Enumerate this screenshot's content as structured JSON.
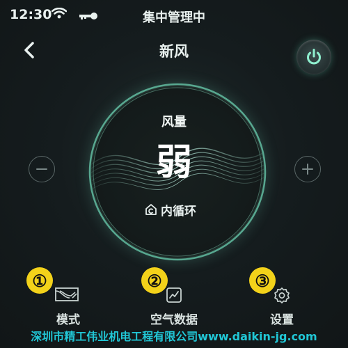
{
  "status_bar": {
    "time": "12:30",
    "center_text": "集中管理中",
    "icons": [
      "wifi-icon",
      "key-icon"
    ]
  },
  "header": {
    "title": "新风",
    "back_icon": "chevron-left-icon",
    "power_icon": "power-icon"
  },
  "control": {
    "label": "风量",
    "value": "弱",
    "mode_text": "内循环",
    "mode_icon": "inner-circulation-icon",
    "decrease_icon": "minus-icon",
    "increase_icon": "plus-icon"
  },
  "nav": [
    {
      "number": "①",
      "label": "模式",
      "icon": "mode-icon"
    },
    {
      "number": "②",
      "label": "空气数据",
      "icon": "air-data-icon"
    },
    {
      "number": "③",
      "label": "设置",
      "icon": "gear-icon"
    }
  ],
  "watermark": "深圳市精工伟业机电工程有限公司www.daikin-jg.com",
  "colors": {
    "background": "#141a1c",
    "accent": "#7de0c0",
    "annotation_number": "#f3d21a",
    "watermark": "#21c7d6"
  }
}
